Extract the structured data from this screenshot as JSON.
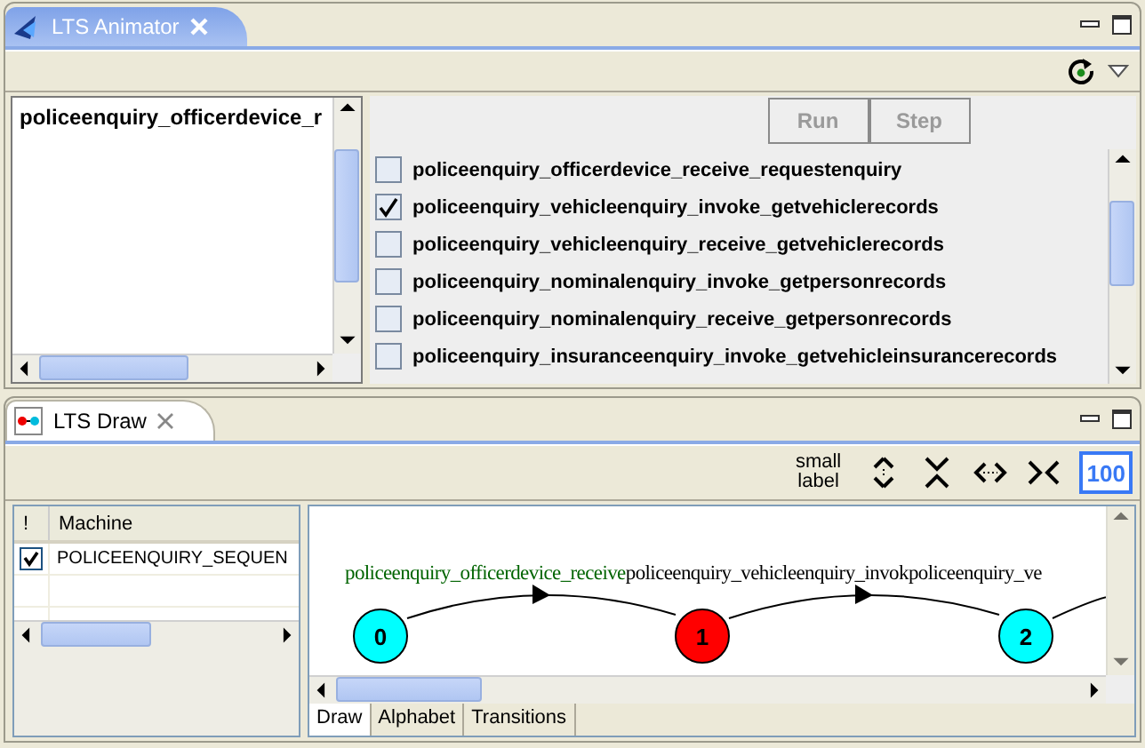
{
  "animator": {
    "tab": {
      "title": "LTS Animator"
    },
    "trace": [
      "policeenquiry_officerdevice_r"
    ],
    "buttons": [
      {
        "label": "Run",
        "disabled": true
      },
      {
        "label": "Step",
        "disabled": true
      }
    ],
    "actions": [
      {
        "label": "policeenquiry_officerdevice_receive_requestenquiry",
        "checked": false
      },
      {
        "label": "policeenquiry_vehicleenquiry_invoke_getvehiclerecords",
        "checked": true
      },
      {
        "label": "policeenquiry_vehicleenquiry_receive_getvehiclerecords",
        "checked": false
      },
      {
        "label": "policeenquiry_nominalenquiry_invoke_getpersonrecords",
        "checked": false
      },
      {
        "label": "policeenquiry_nominalenquiry_receive_getpersonrecords",
        "checked": false
      },
      {
        "label": "policeenquiry_insuranceenquiry_invoke_getvehicleinsurancerecords",
        "checked": false
      }
    ]
  },
  "draw": {
    "tab": {
      "title": "LTS Draw"
    },
    "small_label_button": {
      "label": "small label"
    },
    "zoom_button": {
      "label": "100",
      "selected": true
    },
    "machines": {
      "columns": [
        "!",
        "Machine"
      ],
      "rows": [
        {
          "checked": true,
          "name": "POLICEENQUIRY_SEQUEN"
        }
      ]
    },
    "graph": {
      "nodes": [
        {
          "label": "0",
          "color": "#00ffff"
        },
        {
          "label": "1",
          "color": "#ff0000"
        },
        {
          "label": "2",
          "color": "#00ffff"
        }
      ],
      "edges": [
        {
          "label": "policeenquiry_officerdevice_receive",
          "color": "#006400"
        },
        {
          "label": "policeenquiry_vehicleenquiry_invok",
          "color": "#000000"
        },
        {
          "label": "policeenquiry_ve",
          "color": "#000000"
        }
      ]
    },
    "tabs": [
      {
        "label": "Draw",
        "selected": true
      },
      {
        "label": "Alphabet",
        "selected": false
      },
      {
        "label": "Transitions",
        "selected": false
      }
    ]
  }
}
